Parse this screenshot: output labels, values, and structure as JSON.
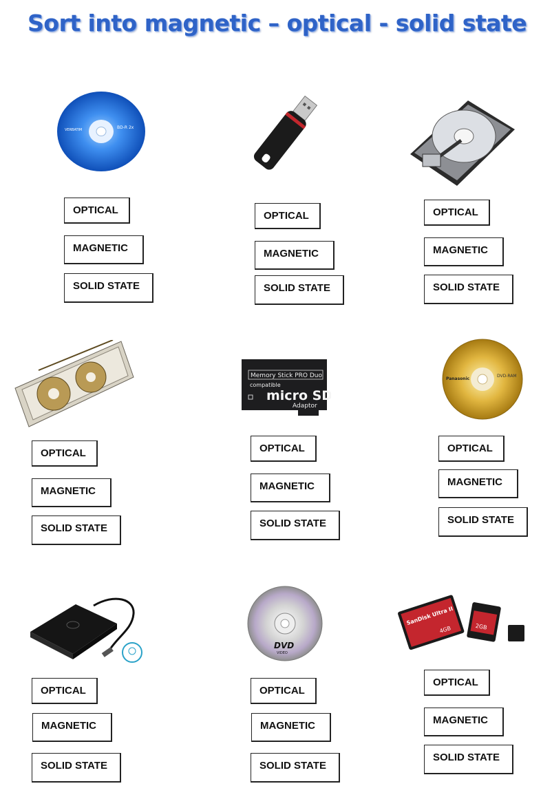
{
  "title": "Sort into magnetic – optical - solid state",
  "options": [
    "OPTICAL",
    "MAGNETIC",
    "SOLID STATE"
  ],
  "devices": [
    {
      "name": "blu-ray-disc",
      "disc_label": "BD-R 2x",
      "brand": "VERBATIM"
    },
    {
      "name": "usb-flash-drive"
    },
    {
      "name": "hard-disk-drive"
    },
    {
      "name": "tape-cartridge"
    },
    {
      "name": "memory-stick-adaptor",
      "line1": "Memory Stick PRO Duo",
      "line2": "compatible",
      "line3": "micro SD",
      "line4": "Adaptor"
    },
    {
      "name": "dvd-ram-disc",
      "brand": "Panasonic",
      "disc_label": "DVD-RAM"
    },
    {
      "name": "external-hard-drive"
    },
    {
      "name": "dvd-disc",
      "logo": "DVD",
      "sub": "VIDEO"
    },
    {
      "name": "memory-cards",
      "card1": "SanDisk Ultra II",
      "card1_size": "4GB",
      "card2_size": "2GB"
    }
  ]
}
